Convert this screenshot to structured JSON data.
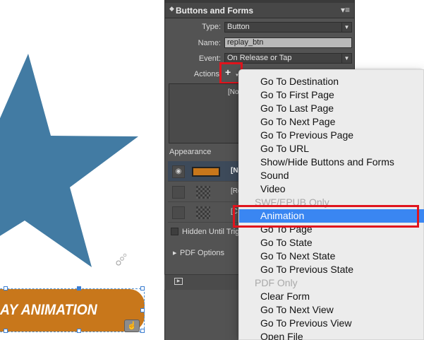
{
  "canvas": {
    "replay_button_text": "AY ANIMATION",
    "hand_cursor_icon": "hand-cursor-icon",
    "star_color": "#427ba3",
    "button_color": "#c8771b"
  },
  "panel": {
    "title": "Buttons and Forms",
    "type_label": "Type:",
    "type_value": "Button",
    "name_label": "Name:",
    "name_value": "replay_btn",
    "event_label": "Event:",
    "event_value": "On Release or Tap",
    "actions_label": "Actions",
    "add_action_icon": "+",
    "actions_list_text": "[No",
    "appearance_label": "Appearance",
    "appearance_rows": [
      {
        "label": "[N",
        "state": "selected"
      },
      {
        "label": "[Ro",
        "state": "normal"
      },
      {
        "label": "[C",
        "state": "normal"
      }
    ],
    "hidden_label": "Hidden Until Trigger",
    "pdf_options_label": "PDF Options"
  },
  "menu": {
    "items": [
      {
        "label": "Go To Destination",
        "kind": "item"
      },
      {
        "label": "Go To First Page",
        "kind": "item"
      },
      {
        "label": "Go To Last Page",
        "kind": "item"
      },
      {
        "label": "Go To Next Page",
        "kind": "item"
      },
      {
        "label": "Go To Previous Page",
        "kind": "item"
      },
      {
        "label": "Go To URL",
        "kind": "item"
      },
      {
        "label": "Show/Hide Buttons and Forms",
        "kind": "item"
      },
      {
        "label": "Sound",
        "kind": "item"
      },
      {
        "label": "Video",
        "kind": "item"
      },
      {
        "label": "SWF/EPUB Only",
        "kind": "section"
      },
      {
        "label": "Animation",
        "kind": "selected"
      },
      {
        "label": "Go To Page",
        "kind": "item"
      },
      {
        "label": "Go To State",
        "kind": "item"
      },
      {
        "label": "Go To Next State",
        "kind": "item"
      },
      {
        "label": "Go To Previous State",
        "kind": "item"
      },
      {
        "label": "PDF Only",
        "kind": "section"
      },
      {
        "label": "Clear Form",
        "kind": "item"
      },
      {
        "label": "Go To Next View",
        "kind": "item"
      },
      {
        "label": "Go To Previous View",
        "kind": "item"
      },
      {
        "label": "Open File",
        "kind": "item"
      }
    ]
  }
}
